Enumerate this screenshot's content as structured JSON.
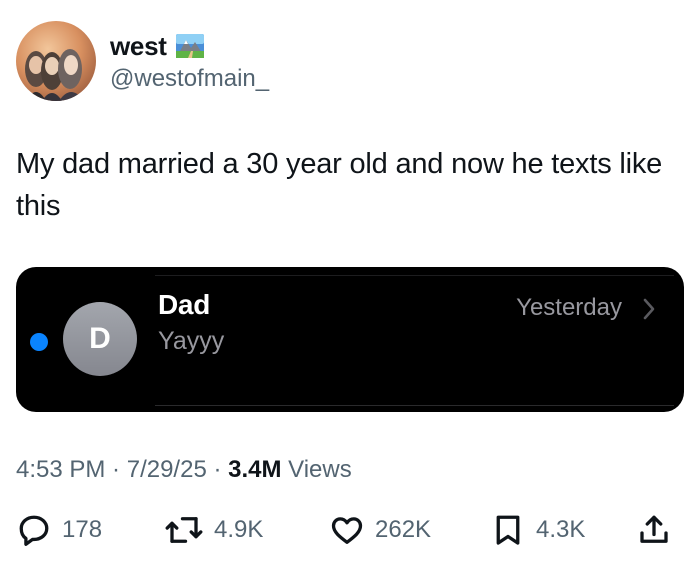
{
  "author": {
    "display_name": "west",
    "handle": "@westofmain_",
    "avatar_icon": "profile-photo-icon",
    "badge_icon": "national-park-emoji-icon"
  },
  "tweet": {
    "text": "My dad married a 30 year old and now he texts like this"
  },
  "media": {
    "contact_initial": "D",
    "contact_name": "Dad",
    "message_preview": "Yayyy",
    "timestamp": "Yesterday",
    "unread_color": "#0a84ff"
  },
  "meta": {
    "time": "4:53 PM",
    "separator": " · ",
    "date": "7/29/25",
    "views_count": "3.4M",
    "views_label": " Views"
  },
  "actions": {
    "replies": "178",
    "retweets": "4.9K",
    "likes": "262K",
    "bookmarks": "4.3K"
  },
  "colors": {
    "text_primary": "#0f1419",
    "text_secondary": "#536471",
    "imessage_blue": "#0a84ff"
  }
}
